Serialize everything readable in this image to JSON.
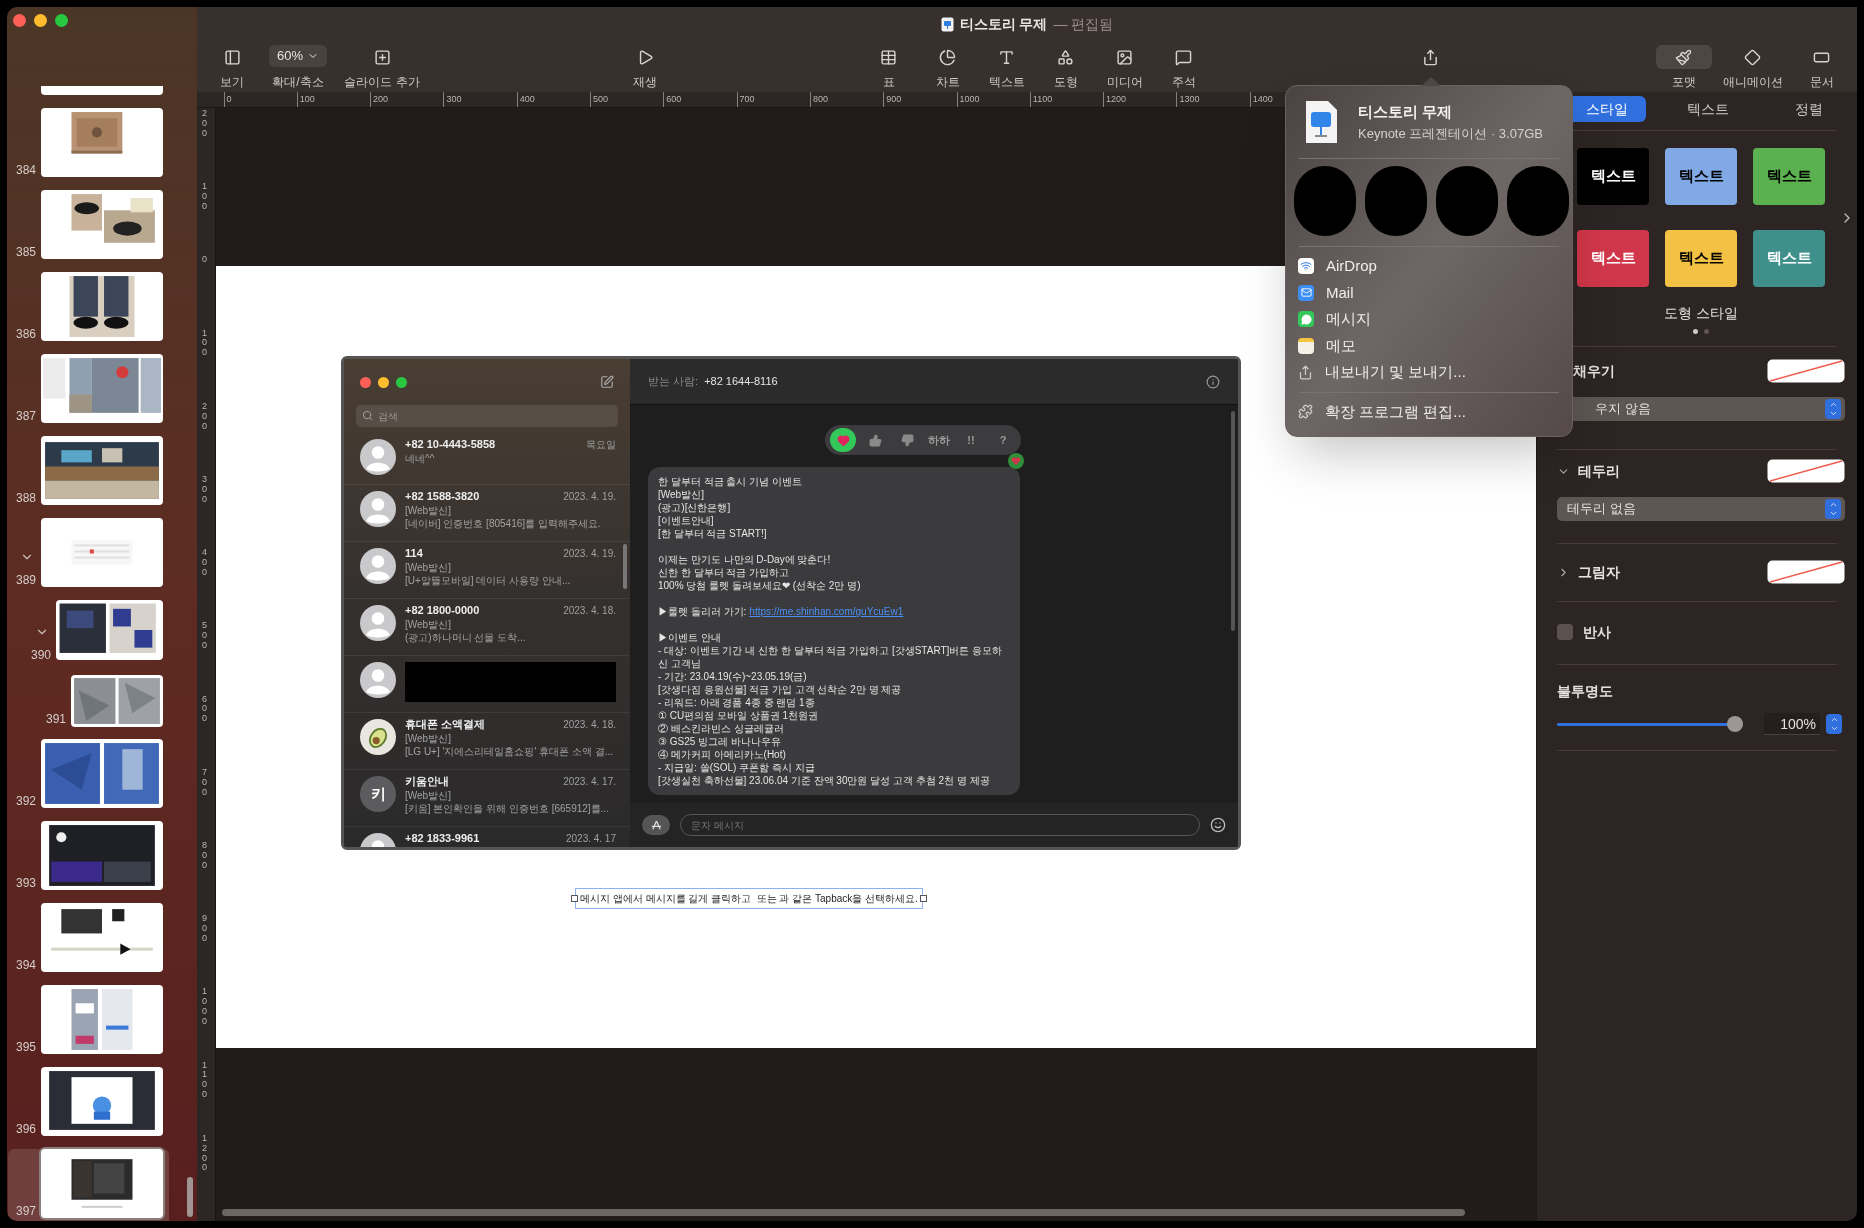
{
  "window": {
    "title": "티스토리 무제",
    "status": "— 편집됨"
  },
  "toolbar": {
    "left": [
      {
        "kind": "view",
        "label": "보기"
      },
      {
        "kind": "zoom",
        "label": "확대/축소",
        "value": "60%"
      },
      {
        "kind": "add-slide",
        "label": "슬라이드 추가"
      }
    ],
    "play": {
      "kind": "play",
      "label": "재생"
    },
    "insert": [
      {
        "kind": "table",
        "label": "표"
      },
      {
        "kind": "chart",
        "label": "차트"
      },
      {
        "kind": "text",
        "label": "텍스트"
      },
      {
        "kind": "shape",
        "label": "도형"
      },
      {
        "kind": "media",
        "label": "미디어"
      },
      {
        "kind": "comment",
        "label": "주석"
      }
    ],
    "share": {
      "kind": "share"
    },
    "right": [
      {
        "kind": "format",
        "label": "포맷",
        "selected": true
      },
      {
        "kind": "animate",
        "label": "애니메이션",
        "selected": false
      },
      {
        "kind": "document",
        "label": "문서",
        "selected": false
      }
    ]
  },
  "ruler": {
    "horizontal": [
      "0",
      "100",
      "200",
      "300",
      "400",
      "500",
      "600",
      "700",
      "800",
      "900",
      "1000",
      "1100",
      "1200",
      "1300",
      "1400"
    ],
    "vertical": [
      "200",
      "100",
      "0",
      "100",
      "200",
      "300",
      "400",
      "500",
      "600",
      "700",
      "800",
      "900",
      "1000",
      "1100",
      "1200"
    ]
  },
  "slides": [
    {
      "number": "384",
      "selected": false
    },
    {
      "number": "385",
      "selected": false
    },
    {
      "number": "386",
      "selected": false
    },
    {
      "number": "387",
      "selected": false
    },
    {
      "number": "388",
      "selected": false
    },
    {
      "number": "389",
      "selected": false,
      "expanded": true,
      "children": [
        {
          "number": "390",
          "selected": false,
          "expanded": true,
          "children": [
            {
              "number": "391",
              "selected": false
            }
          ]
        }
      ]
    },
    {
      "number": "392",
      "selected": false
    },
    {
      "number": "393",
      "selected": false
    },
    {
      "number": "394",
      "selected": false
    },
    {
      "number": "395",
      "selected": false
    },
    {
      "number": "396",
      "selected": false
    },
    {
      "number": "397",
      "selected": true
    }
  ],
  "slide": {
    "messages_app": {
      "search": {
        "placeholder": "검색"
      },
      "conversations": [
        {
          "kind": "conversation",
          "avatar": {
            "kind": "person"
          },
          "name": "+82 10-4443-5858",
          "date": "목요일",
          "lines": [
            "네네^^"
          ]
        },
        {
          "kind": "conversation",
          "avatar": {
            "kind": "person"
          },
          "name": "+82 1588-3820",
          "date": "2023. 4. 19.",
          "lines": [
            "[Web발신]",
            "[네이버] 인증번호 [805416]를 입력해주세요."
          ]
        },
        {
          "kind": "conversation",
          "avatar": {
            "kind": "person"
          },
          "name": "114",
          "date": "2023. 4. 19.",
          "lines": [
            "[Web발신]",
            "[U+알뜰모바일] 데이터 사용량 안내..."
          ]
        },
        {
          "kind": "conversation",
          "avatar": {
            "kind": "person"
          },
          "name": "+82 1800-0000",
          "date": "2023. 4. 18.",
          "lines": [
            "[Web발신]",
            "(광고)하나머니 선물 도착..."
          ]
        },
        {
          "kind": "redacted",
          "avatar": {
            "kind": "person"
          }
        },
        {
          "kind": "conversation",
          "avatar": {
            "kind": "avocado"
          },
          "name": "휴대폰 소액결제",
          "date": "2023. 4. 18.",
          "lines": [
            "[Web발신]",
            "[LG U+] '지에스리테일홈쇼핑' 휴대폰 소액 결..."
          ]
        },
        {
          "kind": "conversation",
          "avatar": {
            "kind": "letter",
            "text": "키"
          },
          "name": "키움안내",
          "date": "2023. 4. 17.",
          "lines": [
            "[Web발신]",
            "[키움] 본인확인을 위해 인증번호 [665912]를..."
          ]
        },
        {
          "kind": "conversation",
          "avatar": {
            "kind": "person"
          },
          "name": "+82 1833-9961",
          "date": "2023. 4. 17"
        }
      ],
      "recipient": {
        "label": "받는 사람:",
        "value": "+82 1644-8116"
      },
      "tapbacks": [
        {
          "kind": "heart",
          "selected": true
        },
        {
          "kind": "thumbs-up",
          "selected": false
        },
        {
          "kind": "thumbs-down",
          "selected": false
        },
        {
          "kind": "text",
          "text": "하하",
          "selected": false
        },
        {
          "kind": "text",
          "text": "!!",
          "selected": false
        },
        {
          "kind": "text",
          "text": "?",
          "selected": false
        }
      ],
      "message": [
        [
          {
            "text": "한 달부터 적금 출시 기념 이벤트"
          },
          {
            "text": "[Web발신]"
          },
          {
            "text": "(광고)[신한은행]"
          },
          {
            "text": "[이벤트안내]"
          },
          {
            "text": "[한 달부터 적금 START!]"
          }
        ],
        [
          {
            "text": "이제는 만기도 나만의 D-Day에 맞춘다!"
          },
          {
            "text": "신한 한 달부터 적금 가입하고"
          },
          {
            "text": "100% 당첨 룰렛 돌려보세요❤ (선착순 2만 명)"
          }
        ],
        [
          {
            "text": "▶룰렛 돌리러 가기:",
            "link": "https://me.shinhan.com/guYcuEw1"
          }
        ],
        [
          {
            "text": "▶이벤트 안내"
          },
          {
            "text": "- 대상: 이벤트 기간 내 신한 한 달부터 적금 가입하고 [갓생START]버튼 응모하신 고객님"
          },
          {
            "text": "- 기간: 23.04.19(수)~23.05.19(금)"
          },
          {
            "text": "[갓생다짐 응원선물] 적금 가입 고객 선착순 2만 명 제공"
          },
          {
            "text": "- 리워드: 아래 경품 4종 중 랜덤 1종"
          },
          {
            "text": "① CU편의점 모바일 상품권 1천원권"
          },
          {
            "text": "② 배스킨라빈스 싱글레귤러"
          },
          {
            "text": "③ GS25 빙그레 바나나우유"
          },
          {
            "text": "④ 메가커피 아메리카노(Hot)"
          },
          {
            "text": "- 지급일: 쏠(SOL) 쿠폰함 즉시 지급"
          },
          {
            "text": "[갓생실천 축하선물] 23.06.04 기준 잔액 30만원 달성 고객 추첨 2천 명 제공"
          }
        ]
      ],
      "composer": {
        "placeholder": "문자 메시지"
      }
    },
    "caption": {
      "text": "메시지 앱에서 메시지를 길게 클릭하고  또는 과 같은 Tapback을 선택하세요.",
      "selected": true
    }
  },
  "share_menu": {
    "file": {
      "name": "티스토리 무제",
      "info": "Keynote 프레젠테이션 · 3.07GB"
    },
    "contacts": [
      {
        "kind": "redacted"
      },
      {
        "kind": "redacted"
      },
      {
        "kind": "redacted"
      },
      {
        "kind": "redacted"
      }
    ],
    "actions": [
      {
        "kind": "airdrop",
        "label": "AirDrop"
      },
      {
        "kind": "mail",
        "label": "Mail"
      },
      {
        "kind": "messages",
        "label": "메시지"
      },
      {
        "kind": "notes",
        "label": "메모"
      },
      {
        "kind": "export",
        "label": "내보내기 및 보내기..."
      }
    ],
    "footer": [
      {
        "kind": "extensions",
        "label": "확장 프로그램 편집..."
      }
    ]
  },
  "inspector": {
    "tabs": [
      {
        "label": "스타일",
        "selected": true
      },
      {
        "label": "텍스트",
        "selected": false
      },
      {
        "label": "정렬",
        "selected": false
      }
    ],
    "styles": [
      {
        "label": "텍스트",
        "color": "#000000",
        "kind": "light"
      },
      {
        "label": "텍스트",
        "color": "#80a9e6",
        "kind": "dark"
      },
      {
        "label": "텍스트",
        "color": "#5bb14f",
        "kind": "dark"
      },
      {
        "label": "텍스트",
        "color": "#d1374a",
        "kind": "light"
      },
      {
        "label": "텍스트",
        "color": "#f3c244",
        "kind": "dark"
      },
      {
        "label": "텍스트",
        "color": "#3f8f8c",
        "kind": "light"
      }
    ],
    "styles_title": "도형 스타일",
    "pages": [
      {
        "selected": true
      },
      {
        "selected": false
      }
    ],
    "fill": {
      "label": "채우기",
      "value": "우지 않음"
    },
    "border": {
      "label": "테두리",
      "expanded": true,
      "value": "테두리 없음"
    },
    "shadow": {
      "label": "그림자",
      "expanded": false
    },
    "reflection": {
      "label": "반사",
      "checked": false
    },
    "opacity": {
      "label": "불투명도",
      "level": 1,
      "reading": "100%"
    }
  }
}
